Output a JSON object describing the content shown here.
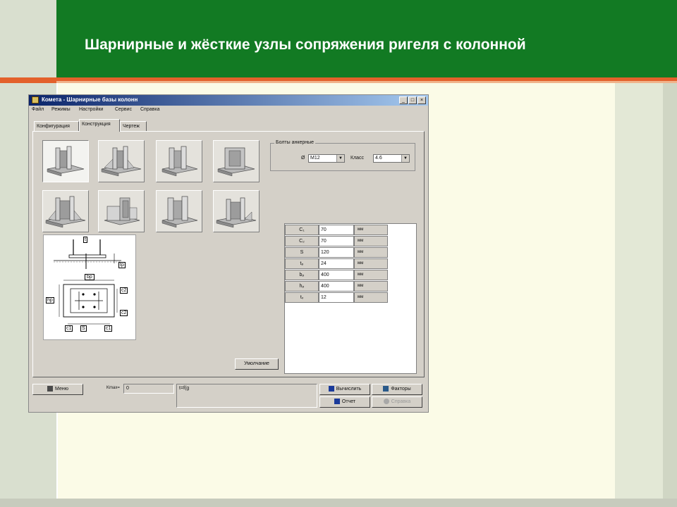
{
  "slide": {
    "title": "Шарнирные и жёсткие узлы сопряжения ригеля с колонной",
    "colors": {
      "header_green": "#127a23",
      "accent_orange": "#e3612b",
      "panel_cream": "#fbfbe7"
    }
  },
  "window": {
    "title": "Кометa - Шарнирные базы колонн",
    "controls": {
      "minimize": "_",
      "maximize": "□",
      "close": "×"
    },
    "menu": [
      "Файл",
      "Режимы",
      "Настройки",
      "Сервис",
      "Справка"
    ],
    "tabs": [
      {
        "label": "Конфигурация",
        "active": false
      },
      {
        "label": "Конструкция",
        "active": true
      },
      {
        "label": "Чертеж",
        "active": false
      }
    ],
    "thumbnails": [
      {
        "name": "base-variant-1",
        "selected": true
      },
      {
        "name": "base-variant-2",
        "selected": false
      },
      {
        "name": "base-variant-3",
        "selected": false
      },
      {
        "name": "base-variant-4",
        "selected": false
      },
      {
        "name": "base-variant-5",
        "selected": false
      },
      {
        "name": "base-variant-6",
        "selected": false
      },
      {
        "name": "base-variant-7",
        "selected": false
      },
      {
        "name": "base-variant-8",
        "selected": false
      }
    ],
    "bolts": {
      "legend": "Болты анкерные",
      "diameter_label": "Ø",
      "diameter_value": "M12",
      "class_label": "Класс",
      "class_value": "4.6"
    },
    "drawing_labels": {
      "t": "t",
      "tp": "tp",
      "bp": "bp",
      "hp": "hp",
      "c1": "c1",
      "c2": "c2",
      "s": "S"
    },
    "params": [
      {
        "name": "C₁",
        "value": "70",
        "unit": "мм"
      },
      {
        "name": "C₂",
        "value": "70",
        "unit": "мм"
      },
      {
        "name": "S",
        "value": "120",
        "unit": "мм"
      },
      {
        "name": "tₚ",
        "value": "24",
        "unit": "мм"
      },
      {
        "name": "bₚ",
        "value": "400",
        "unit": "мм"
      },
      {
        "name": "hₚ",
        "value": "400",
        "unit": "мм"
      },
      {
        "name": "tᵥ",
        "value": "12",
        "unit": "мм"
      }
    ],
    "defaults_button": "Умолчание",
    "statusbar": {
      "menu_button": "Меню",
      "k_label": "Kmax=",
      "k_value": "0",
      "formula": "t=f(g",
      "calculate_button": "Вычислить",
      "factors_button": "Факторы",
      "report_button": "Отчет",
      "help_button": "Справка"
    }
  }
}
